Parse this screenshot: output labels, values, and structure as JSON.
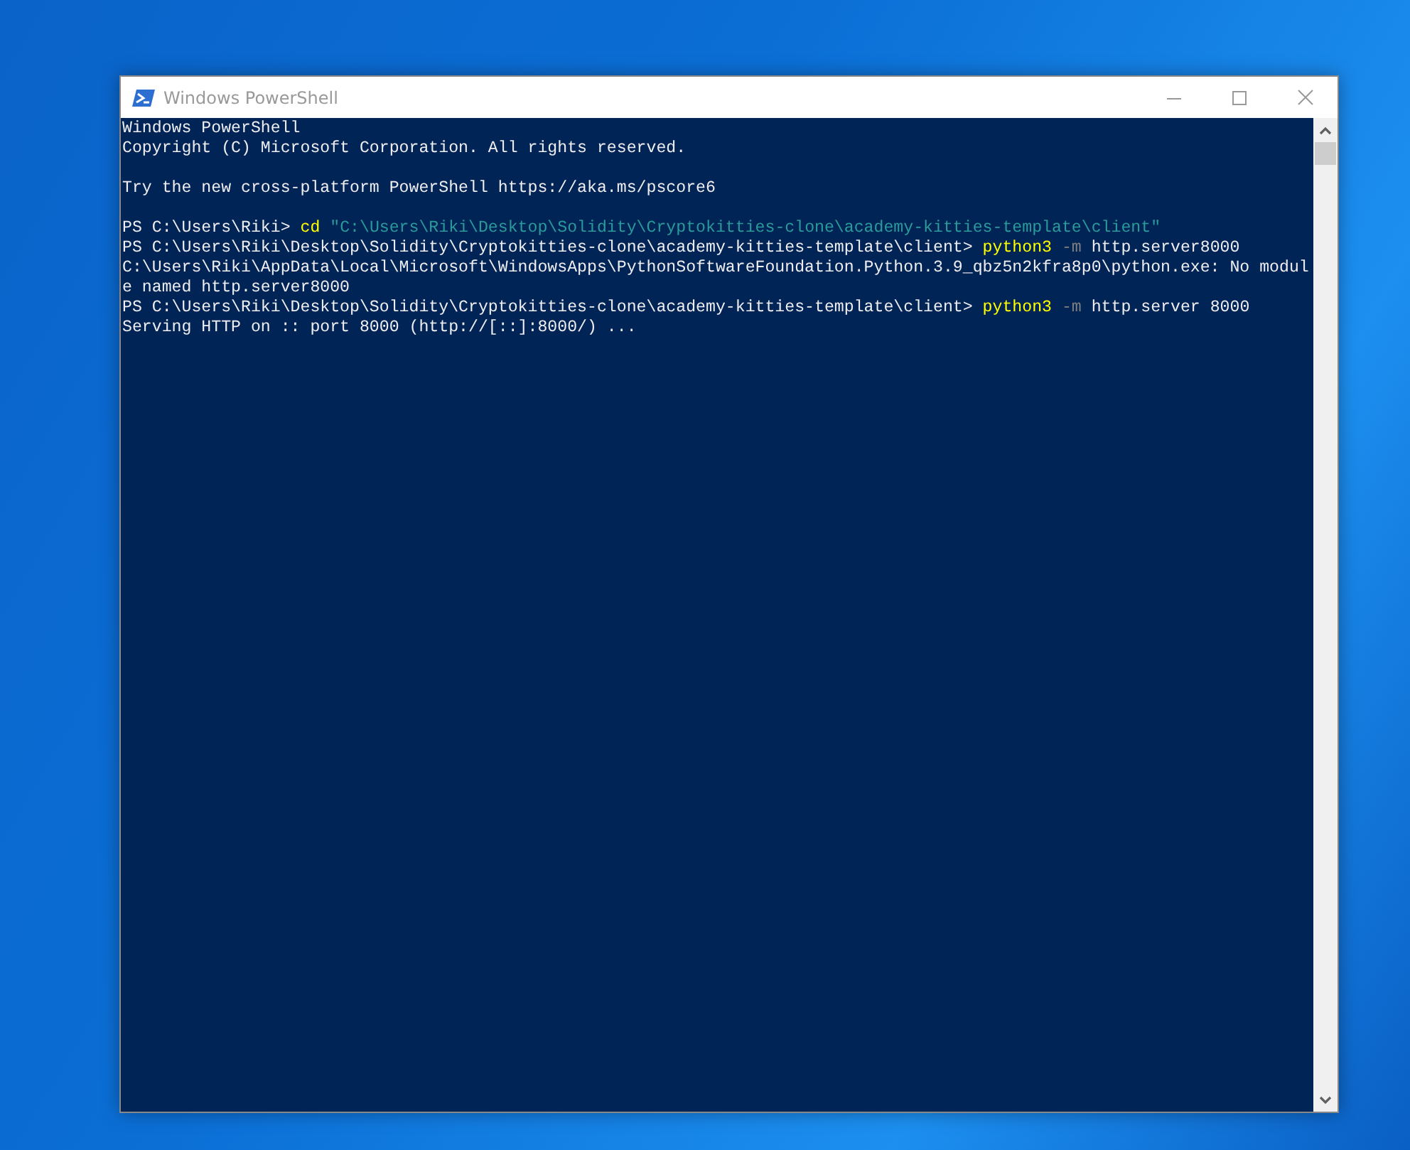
{
  "window": {
    "title": "Windows PowerShell"
  },
  "console": {
    "lines": [
      {
        "segments": [
          {
            "kind": "plain",
            "text": "Windows PowerShell"
          }
        ]
      },
      {
        "segments": [
          {
            "kind": "plain",
            "text": "Copyright (C) Microsoft Corporation. All rights reserved."
          }
        ]
      },
      {
        "gap_before": true,
        "segments": [
          {
            "kind": "plain",
            "text": "Try the new cross-platform PowerShell https://aka.ms/pscore6"
          }
        ]
      },
      {
        "gap_before": true,
        "segments": [
          {
            "kind": "plain",
            "text": "PS C:\\Users\\Riki> "
          },
          {
            "kind": "command",
            "text": "cd "
          },
          {
            "kind": "string",
            "text": "\"C:\\Users\\Riki\\Desktop\\Solidity\\Cryptokitties-clone\\academy-kitties-template\\client\""
          }
        ]
      },
      {
        "segments": [
          {
            "kind": "plain",
            "text": "PS C:\\Users\\Riki\\Desktop\\Solidity\\Cryptokitties-clone\\academy-kitties-template\\client> "
          },
          {
            "kind": "command",
            "text": "python3 "
          },
          {
            "kind": "parameter",
            "text": "-m"
          },
          {
            "kind": "plain",
            "text": " http.server8000"
          }
        ]
      },
      {
        "segments": [
          {
            "kind": "plain",
            "text": "C:\\Users\\Riki\\AppData\\Local\\Microsoft\\WindowsApps\\PythonSoftwareFoundation.Python.3.9_qbz5n2kfra8p0\\python.exe: No modul"
          }
        ]
      },
      {
        "segments": [
          {
            "kind": "plain",
            "text": "e named http.server8000"
          }
        ]
      },
      {
        "segments": [
          {
            "kind": "plain",
            "text": "PS C:\\Users\\Riki\\Desktop\\Solidity\\Cryptokitties-clone\\academy-kitties-template\\client> "
          },
          {
            "kind": "command",
            "text": "python3 "
          },
          {
            "kind": "parameter",
            "text": "-m"
          },
          {
            "kind": "plain",
            "text": " http.server 8000"
          }
        ]
      },
      {
        "segments": [
          {
            "kind": "plain",
            "text": "Serving HTTP on :: port 8000 (http://[::]:8000/) ..."
          }
        ]
      }
    ]
  }
}
